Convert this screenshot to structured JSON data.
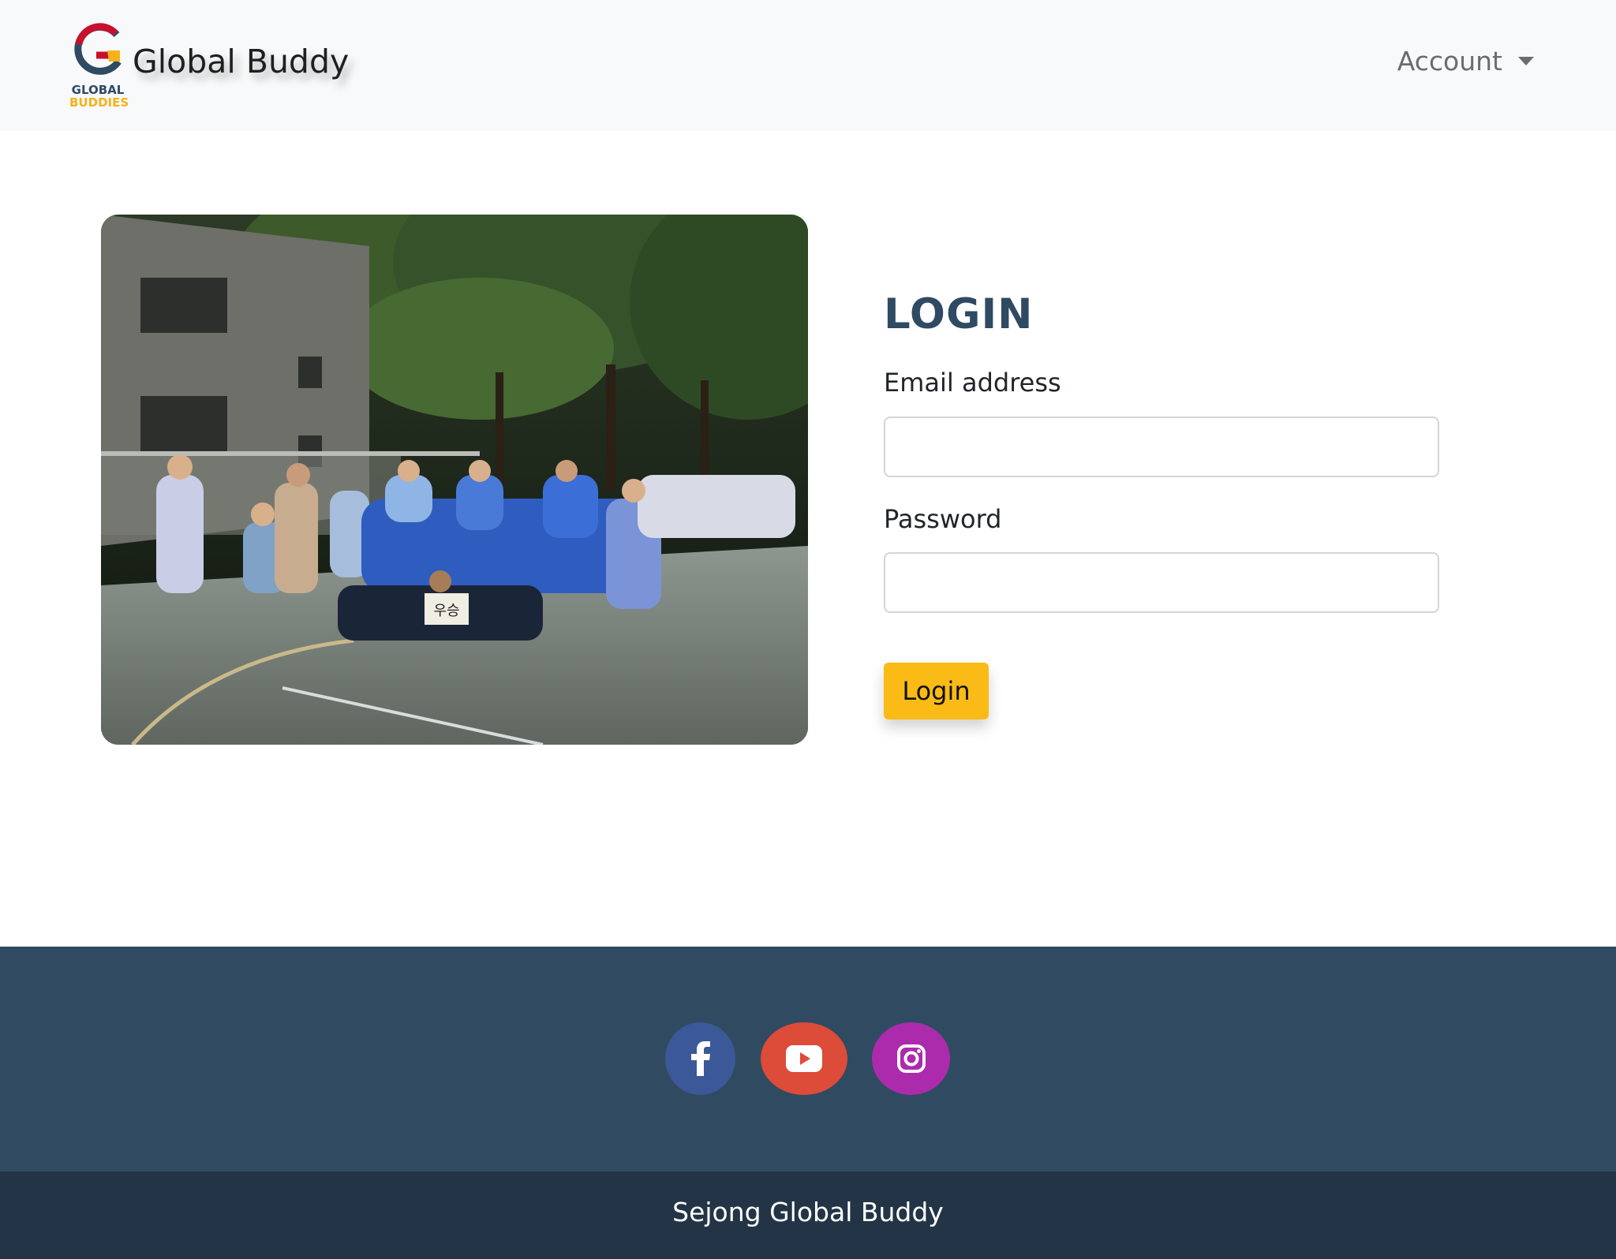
{
  "navbar": {
    "brand_name": "Global Buddy",
    "logo_line1": "GLOBAL",
    "logo_line2": "BUDDIES",
    "account_label": "Account"
  },
  "hero": {
    "sign_text": "우승"
  },
  "login": {
    "title": "LOGIN",
    "email_label": "Email address",
    "email_value": "",
    "email_placeholder": "",
    "password_label": "Password",
    "password_value": "",
    "password_placeholder": "",
    "button_label": "Login"
  },
  "footer": {
    "social": [
      {
        "name": "facebook-icon",
        "color": "#3b5998"
      },
      {
        "name": "youtube-icon",
        "color": "#dd4b39"
      },
      {
        "name": "instagram-icon",
        "color": "#ac2bac"
      }
    ],
    "copyright": "Sejong Global Buddy"
  },
  "colors": {
    "navbar_bg": "#f8f9fa",
    "title": "#2f4a62",
    "button": "#fbbb16",
    "footer_top": "#304b61",
    "footer_bottom": "#223446"
  }
}
